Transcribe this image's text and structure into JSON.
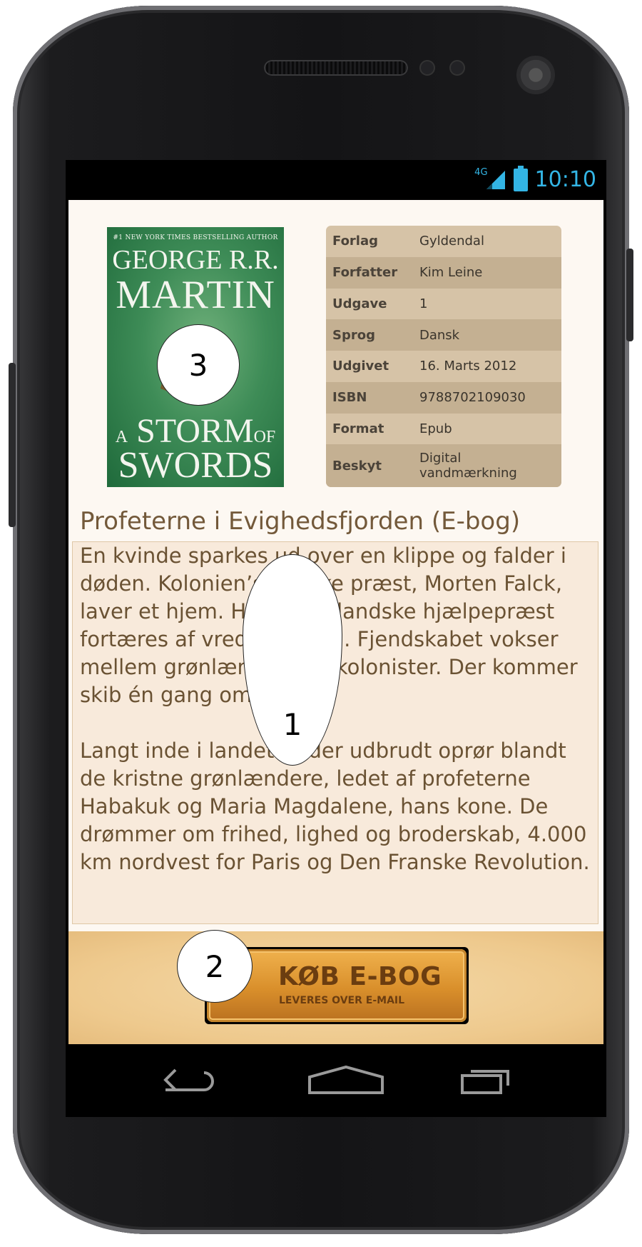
{
  "status_bar": {
    "network": "4G",
    "time": "10:10"
  },
  "cover": {
    "tagline": "#1 NEW YORK TIMES BESTSELLING AUTHOR",
    "author_line1": "GEORGE R.R.",
    "author_line2": "MARTIN",
    "title_a": "A",
    "title_line1": "STORM",
    "title_of": "OF",
    "title_line2": "SWORDS"
  },
  "details": [
    {
      "label": "Forlag",
      "value": "Gyldendal"
    },
    {
      "label": "Forfatter",
      "value": "Kim Leine"
    },
    {
      "label": "Udgave",
      "value": "1"
    },
    {
      "label": "Sprog",
      "value": "Dansk"
    },
    {
      "label": "Udgivet",
      "value": "16. Marts 2012"
    },
    {
      "label": "ISBN",
      "value": "9788702109030"
    },
    {
      "label": "Format",
      "value": "Epub"
    },
    {
      "label": "Beskyt",
      "value": "Digital vandmærkning"
    }
  ],
  "book_title": "Profeterne i Evighedsfjorden (E-bog)",
  "description": {
    "paragraph1": "En kvinde sparkes ud over en klippe og falder i døden. Kolonien’s danske præst, Morten Falck, laver et hjem. Hans grønlandske hjælpepræst fortæres af vrede og sorg. Fjendskabet vokser mellem grønlændere og kolonister. Der kommer skib én gang om året.",
    "paragraph2": "Langt inde i landet er der udbrudt oprør blandt de kristne grønlændere, ledet af profeterne Habakuk og Maria Magdalene, hans kone. De drømmer om frihed, lighed og broderskab, 4.000 km nordvest for Paris og Den Franske Revolution."
  },
  "buy_button": {
    "label": "KØB E-BOG",
    "sublabel": "LEVERES OVER E-MAIL"
  },
  "markers": {
    "m1": "1",
    "m2": "2",
    "m3": "3"
  },
  "colors": {
    "status_accent": "#33b5e5",
    "title": "#73593a",
    "table_bg": "#d6c3a7"
  }
}
